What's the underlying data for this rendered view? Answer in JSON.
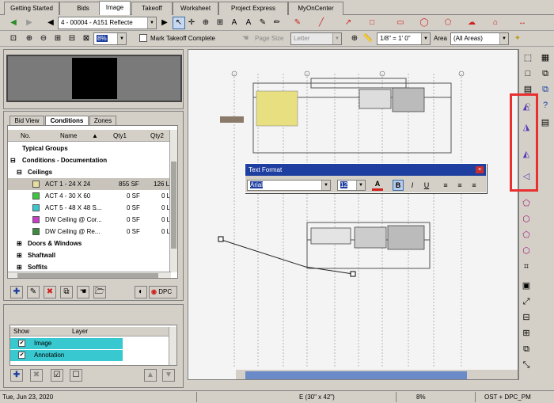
{
  "tabs": [
    "Getting Started",
    "Bids",
    "Image",
    "Takeoff",
    "Worksheet",
    "Project Express",
    "MyOnCenter"
  ],
  "active_tab": "Image",
  "page_select": "4 - 00004 - A151 Reflecte",
  "zoom_value": "8%",
  "mark_takeoff": "Mark Takeoff Complete",
  "page_size_label": "Page Size",
  "page_size_value": "Letter",
  "scale_value": "1/8\" = 1' 0\"",
  "area_label": "Area",
  "area_value": "(All Areas)",
  "condition_tabs": [
    "Bid View",
    "Conditions",
    "Zones"
  ],
  "columns": {
    "no": "No.",
    "name": "Name",
    "qty1": "Qty1",
    "qty2": "Qty2"
  },
  "groups": {
    "typical": "Typical Groups",
    "conditions_doc": "Conditions - Documentation",
    "ceilings": "Ceilings",
    "doors": "Doors & Windows",
    "shaftwall": "Shaftwall",
    "soffits": "Soffits"
  },
  "conditions": [
    {
      "name": "ACT 1 - 24 X 24",
      "qty1": "855 SF",
      "qty2": "126 L",
      "color": "#e8dea0"
    },
    {
      "name": "ACT 4 - 30 X 60",
      "qty1": "0 SF",
      "qty2": "0 L",
      "color": "#3cc83c"
    },
    {
      "name": "ACT 5 - 48 X 48 S...",
      "qty1": "0 SF",
      "qty2": "0 L",
      "color": "#38c8d0"
    },
    {
      "name": "DW Ceiling @ Cor...",
      "qty1": "0 SF",
      "qty2": "0 L",
      "color": "#c83cc8"
    },
    {
      "name": "DW Ceiling @ Re...",
      "qty1": "0 SF",
      "qty2": "0 L",
      "color": "#3c8a3c"
    }
  ],
  "dpc_label": "DPC",
  "layers": {
    "show": "Show",
    "layer": "Layer",
    "items": [
      "Image",
      "Annotation"
    ]
  },
  "text_format": {
    "title": "Text Format",
    "font": "Arial",
    "size": "12",
    "bold": "B",
    "italic": "I",
    "underline": "U"
  },
  "status": {
    "date": "Tue, Jun 23, 2020",
    "page": "E (30\" x 42\")",
    "zoom": "8%",
    "mode": "OST + DPC_PM"
  }
}
